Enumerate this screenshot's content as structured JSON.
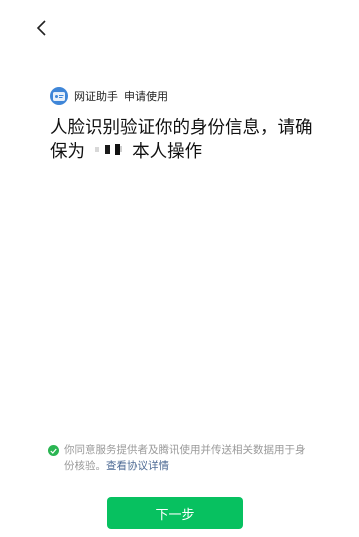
{
  "header": {
    "back_icon": "chevron-left-icon"
  },
  "app": {
    "logo_icon": "id-card-icon",
    "name": "网证助手",
    "request_text": "申请使用"
  },
  "main": {
    "headline_prefix": "人脸识别验证你的身份信息，请确保为",
    "headline_suffix": "本人操作"
  },
  "consent": {
    "text": "你同意服务提供者及腾讯使用并传送相关数据用于身份核验。",
    "link_label": "查看协议详情"
  },
  "footer": {
    "next_label": "下一步"
  },
  "colors": {
    "primary_green": "#07c160",
    "link_blue": "#4d6a94",
    "muted_text": "#999999"
  }
}
